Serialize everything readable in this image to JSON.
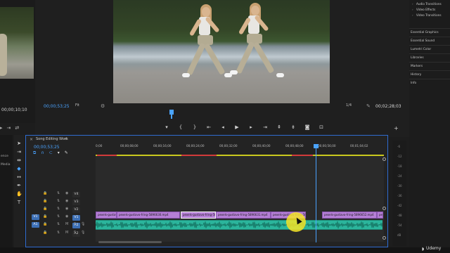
{
  "source_monitor": {
    "timecode": "00;00;10;10"
  },
  "program_monitor": {
    "timecode_current": "00;00;53;25",
    "fit": "Fit",
    "resolution": "1/4",
    "timecode_duration": "00;02;28;03"
  },
  "right_panel": {
    "tree": [
      "Audio Transitions",
      "Video Effects",
      "Video Transitions"
    ],
    "items": [
      "Essential Graphics",
      "Essential Sound",
      "Lumetri Color",
      "Libraries",
      "Markers",
      "History",
      "Info"
    ]
  },
  "timeline": {
    "sequence_name": "Song Editing Work",
    "menu_icon": "≡",
    "timecode": "00;00;53;25",
    "ruler_ticks": [
      "0;00",
      "00;00;08;00",
      "00;00;16;00",
      "00;00;24;00",
      "00;00;32;00",
      "00;00;40;00",
      "00;00;48;00",
      "00;00;56;00",
      "00;01;04;02"
    ],
    "tracks": [
      {
        "label": "V4"
      },
      {
        "label": "V3"
      },
      {
        "label": "V2"
      },
      {
        "label": "V1"
      },
      {
        "label": "A1"
      },
      {
        "label": "A2"
      }
    ],
    "patch_v": "V1",
    "patch_a": "A1",
    "clips": [
      "pexels-gustavo-fring-1959...",
      "pexels-gustavo-fring-5896630.mp4",
      "pexels-gustavo-fring-5896630.mp4",
      "pexels-gustavo-fring-5896631.mp4",
      "pexels-gustavo-fring-5896630.mp4",
      "pexels-gustavo-fring-5896652.mp4",
      "pex"
    ]
  },
  "left_column": {
    "labels": [
      "Media",
      "ence"
    ]
  },
  "meter_scale": [
    "-6",
    "-12",
    "-18",
    "-24",
    "-30",
    "-36",
    "-42",
    "-48",
    "-54",
    "dB"
  ],
  "watermark": "Udemy",
  "colors": {
    "accent": "#4aa3ff",
    "clip_video": "#b57fd6",
    "clip_audio": "#2bb59c",
    "work_area": "#c9c81e"
  }
}
